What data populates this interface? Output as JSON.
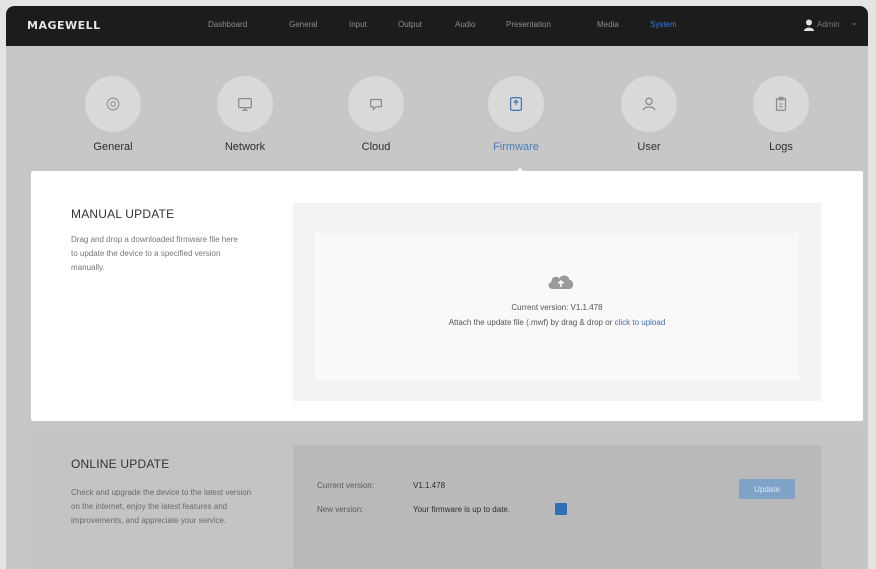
{
  "app": {
    "brand": "MAGEWELL",
    "user": {
      "name": "Admin"
    }
  },
  "nav": {
    "items": [
      {
        "label": "Dashboard"
      },
      {
        "label": "General"
      },
      {
        "label": "Input"
      },
      {
        "label": "Output"
      },
      {
        "label": "Audio"
      },
      {
        "label": "Presentation"
      },
      {
        "label": "Media"
      },
      {
        "label": "System",
        "active": true
      }
    ]
  },
  "tabs": [
    {
      "label": "General",
      "icon": "gear-icon"
    },
    {
      "label": "Network",
      "icon": "monitor-icon"
    },
    {
      "label": "Cloud",
      "icon": "cloud-chat-icon"
    },
    {
      "label": "Firmware",
      "icon": "firmware-icon",
      "active": true
    },
    {
      "label": "User",
      "icon": "user-icon"
    },
    {
      "label": "Logs",
      "icon": "clipboard-icon"
    }
  ],
  "manual_update": {
    "title": "MANUAL UPDATE",
    "description": "Drag and drop a downloaded firmware file here to update the device to a specified version manually.",
    "current_version_text": "Current version: V1.1.478",
    "attach_text": "Attach the update file (.mwf) by drag & drop or",
    "upload_link": "click to upload"
  },
  "online_update": {
    "title": "ONLINE UPDATE",
    "description": "Check and upgrade the device to the latest version on the internet, enjoy the latest features and improvements, and appreciate your service.",
    "current_version_label": "Current version:",
    "current_version_value": "V1.1.478",
    "new_version_label": "New version:",
    "new_version_value": "Your firmware is up to date.",
    "update_button": "Update"
  },
  "colors": {
    "accent": "#3a7bd5",
    "topbar": "#1c1c1d",
    "overlay": "#c7c7c7"
  }
}
